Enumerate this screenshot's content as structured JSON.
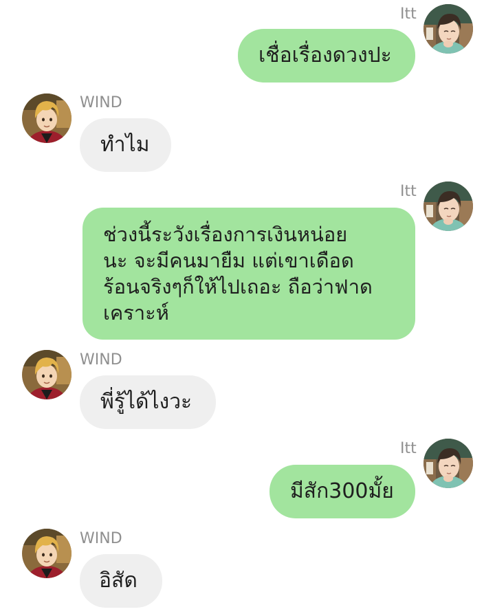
{
  "me": {
    "name": "Itt",
    "avatar_icon": "boy-dark-hair-avatar-icon"
  },
  "friend": {
    "name": "WIND",
    "avatar_icon": "boy-blond-hair-avatar-icon"
  },
  "colors": {
    "outgoing_bubble": "#a2e49e",
    "incoming_bubble": "#efefef",
    "sender_name": "#8f8f8f"
  },
  "messages": [
    {
      "from": "me",
      "sender": "Itt",
      "lines": [
        "เชื่อเรื่องดวงปะ"
      ]
    },
    {
      "from": "friend",
      "sender": "WIND",
      "lines": [
        "ทำไม"
      ]
    },
    {
      "from": "me",
      "sender": "Itt",
      "lines": [
        "ช่วงนี้ระวังเรื่องการเงินหน่อย",
        "นะ จะมีคนมายืม แต่เขาเดือด",
        "ร้อนจริงๆก็ให้ไปเถอะ ถือว่าฟาด",
        "เคราะห์"
      ]
    },
    {
      "from": "friend",
      "sender": "WIND",
      "lines": [
        "พี่รู้ได้ไงวะ"
      ]
    },
    {
      "from": "me",
      "sender": "Itt",
      "lines": [
        "มีสัก300มั้ย"
      ]
    },
    {
      "from": "friend",
      "sender": "WIND",
      "lines": [
        "อิสัด"
      ]
    }
  ]
}
